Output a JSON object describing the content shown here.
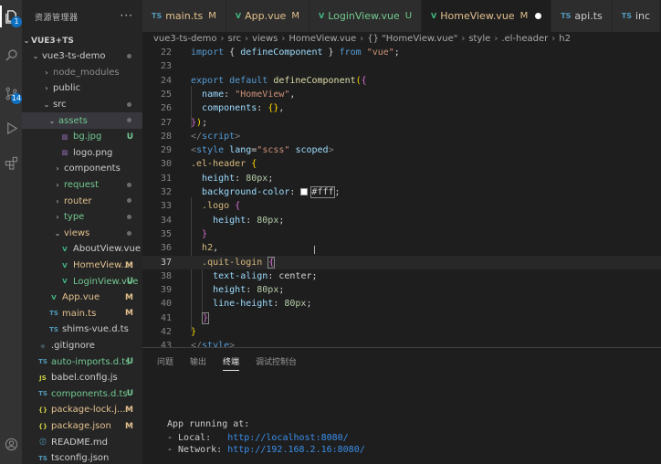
{
  "sidebar": {
    "title": "资源管理器",
    "more": "···",
    "project": "VUE3+TS",
    "items": [
      {
        "label": "vue3-ts-demo",
        "chev": "⌄",
        "color": "#cccccc",
        "icon": "",
        "iconColor": "",
        "dot": true,
        "status": ""
      },
      {
        "label": "node_modules",
        "chev": "›",
        "color": "#8c8c8c",
        "icon": "",
        "iconColor": "",
        "dot": false,
        "status": ""
      },
      {
        "label": "public",
        "chev": "›",
        "color": "#cccccc",
        "icon": "",
        "iconColor": "",
        "dot": false,
        "status": ""
      },
      {
        "label": "src",
        "chev": "⌄",
        "color": "#cccccc",
        "icon": "",
        "iconColor": "",
        "dot": true,
        "status": ""
      },
      {
        "label": "assets",
        "chev": "⌄",
        "color": "#73c991",
        "icon": "",
        "iconColor": "",
        "dot": true,
        "status": ""
      },
      {
        "label": "bg.jpg",
        "chev": "",
        "color": "#73c991",
        "icon": "▨",
        "iconColor": "#a074c4",
        "dot": false,
        "status": "U"
      },
      {
        "label": "logo.png",
        "chev": "",
        "color": "#cccccc",
        "icon": "▨",
        "iconColor": "#a074c4",
        "dot": false,
        "status": ""
      },
      {
        "label": "components",
        "chev": "›",
        "color": "#cccccc",
        "icon": "",
        "iconColor": "",
        "dot": false,
        "status": ""
      },
      {
        "label": "request",
        "chev": "›",
        "color": "#73c991",
        "icon": "",
        "iconColor": "",
        "dot": true,
        "status": ""
      },
      {
        "label": "router",
        "chev": "›",
        "color": "#e2c08d",
        "icon": "",
        "iconColor": "",
        "dot": true,
        "status": ""
      },
      {
        "label": "type",
        "chev": "›",
        "color": "#73c991",
        "icon": "",
        "iconColor": "",
        "dot": true,
        "status": ""
      },
      {
        "label": "views",
        "chev": "⌄",
        "color": "#e2c08d",
        "icon": "",
        "iconColor": "",
        "dot": true,
        "status": ""
      },
      {
        "label": "AboutView.vue",
        "chev": "",
        "color": "#cccccc",
        "icon": "V",
        "iconColor": "#41b883",
        "dot": false,
        "status": ""
      },
      {
        "label": "HomeView....",
        "chev": "",
        "color": "#e2c08d",
        "icon": "V",
        "iconColor": "#41b883",
        "dot": false,
        "status": "M"
      },
      {
        "label": "LoginView.vue",
        "chev": "",
        "color": "#73c991",
        "icon": "V",
        "iconColor": "#41b883",
        "dot": false,
        "status": "U"
      },
      {
        "label": "App.vue",
        "chev": "",
        "color": "#e2c08d",
        "icon": "V",
        "iconColor": "#41b883",
        "dot": false,
        "status": "M"
      },
      {
        "label": "main.ts",
        "chev": "",
        "color": "#e2c08d",
        "icon": "TS",
        "iconColor": "#519aba",
        "dot": false,
        "status": "M"
      },
      {
        "label": "shims-vue.d.ts",
        "chev": "",
        "color": "#cccccc",
        "icon": "TS",
        "iconColor": "#519aba",
        "dot": false,
        "status": ""
      },
      {
        "label": ".gitignore",
        "chev": "",
        "color": "#cccccc",
        "icon": "◆",
        "iconColor": "#41535b",
        "dot": false,
        "status": ""
      },
      {
        "label": "auto-imports.d.ts",
        "chev": "",
        "color": "#73c991",
        "icon": "TS",
        "iconColor": "#519aba",
        "dot": false,
        "status": "U"
      },
      {
        "label": "babel.config.js",
        "chev": "",
        "color": "#cccccc",
        "icon": "JS",
        "iconColor": "#cbcb41",
        "dot": false,
        "status": ""
      },
      {
        "label": "components.d.ts",
        "chev": "",
        "color": "#73c991",
        "icon": "TS",
        "iconColor": "#519aba",
        "dot": false,
        "status": "U"
      },
      {
        "label": "package-lock.j...",
        "chev": "",
        "color": "#e2c08d",
        "icon": "{}",
        "iconColor": "#cbcb41",
        "dot": false,
        "status": "M"
      },
      {
        "label": "package.json",
        "chev": "",
        "color": "#e2c08d",
        "icon": "{}",
        "iconColor": "#cbcb41",
        "dot": false,
        "status": "M"
      },
      {
        "label": "README.md",
        "chev": "",
        "color": "#cccccc",
        "icon": "ⓘ",
        "iconColor": "#519aba",
        "dot": false,
        "status": ""
      },
      {
        "label": "tsconfig.json",
        "chev": "",
        "color": "#cccccc",
        "icon": "TS",
        "iconColor": "#519aba",
        "dot": false,
        "status": ""
      }
    ]
  },
  "activity": {
    "explorer_badge": "1",
    "scm_badge": "14"
  },
  "tabs": [
    {
      "icon": "TS",
      "iconColor": "#519aba",
      "label": "main.ts",
      "status": "M",
      "color": "#e2c08d",
      "active": false
    },
    {
      "icon": "V",
      "iconColor": "#41b883",
      "label": "App.vue",
      "status": "M",
      "color": "#e2c08d",
      "active": false
    },
    {
      "icon": "V",
      "iconColor": "#41b883",
      "label": "LoginView.vue",
      "status": "U",
      "color": "#73c991",
      "active": false
    },
    {
      "icon": "V",
      "iconColor": "#41b883",
      "label": "HomeView.vue",
      "status": "M",
      "color": "#e2c08d",
      "active": true
    },
    {
      "icon": "TS",
      "iconColor": "#519aba",
      "label": "api.ts",
      "status": "",
      "color": "#cccccc",
      "active": false
    },
    {
      "icon": "TS",
      "iconColor": "#519aba",
      "label": "inc",
      "status": "",
      "color": "#cccccc",
      "active": false
    }
  ],
  "breadcrumb": [
    "vue3-ts-demo",
    "src",
    "views",
    "HomeView.vue",
    "{} \"HomeView.vue\"",
    "style",
    ".el-header",
    "h2"
  ],
  "editor": {
    "current_line": 37,
    "lines": [
      {
        "n": 22,
        "parts": [
          [
            "k",
            "import"
          ],
          [
            "pn",
            " { "
          ],
          [
            "p",
            "defineComponent"
          ],
          [
            "pn",
            " } "
          ],
          [
            "k",
            "from"
          ],
          [
            "pn",
            " "
          ],
          [
            "s",
            "\"vue\""
          ],
          [
            "pn",
            ";"
          ]
        ]
      },
      {
        "n": 23,
        "parts": []
      },
      {
        "n": 24,
        "parts": [
          [
            "k",
            "export default"
          ],
          [
            "pn",
            " "
          ],
          [
            "f",
            "defineComponent"
          ],
          [
            "br",
            "("
          ],
          [
            "br2",
            "{"
          ]
        ]
      },
      {
        "n": 25,
        "parts": [
          [
            "pn",
            "  "
          ],
          [
            "p",
            "name"
          ],
          [
            "pn",
            ": "
          ],
          [
            "s",
            "\"HomeView\""
          ],
          [
            "pn",
            ","
          ]
        ]
      },
      {
        "n": 26,
        "parts": [
          [
            "pn",
            "  "
          ],
          [
            "p",
            "components"
          ],
          [
            "pn",
            ": "
          ],
          [
            "br",
            "{}"
          ],
          [
            "pn",
            ","
          ]
        ]
      },
      {
        "n": 27,
        "parts": [
          [
            "br2",
            "}"
          ],
          [
            "br",
            ")"
          ],
          [
            "pn",
            ";"
          ]
        ]
      },
      {
        "n": 28,
        "parts": [
          [
            "t",
            "</"
          ],
          [
            "k",
            "script"
          ],
          [
            "t",
            ">"
          ]
        ]
      },
      {
        "n": 29,
        "parts": [
          [
            "t",
            "<"
          ],
          [
            "k",
            "style"
          ],
          [
            "pn",
            " "
          ],
          [
            "p",
            "lang"
          ],
          [
            "pn",
            "="
          ],
          [
            "s",
            "\"scss\""
          ],
          [
            "pn",
            " "
          ],
          [
            "p",
            "scoped"
          ],
          [
            "t",
            ">"
          ]
        ]
      },
      {
        "n": 30,
        "parts": [
          [
            "sel",
            ".el-header"
          ],
          [
            "pn",
            " "
          ],
          [
            "br",
            "{"
          ]
        ]
      },
      {
        "n": 31,
        "parts": [
          [
            "pn",
            "  "
          ],
          [
            "p",
            "height"
          ],
          [
            "pn",
            ": "
          ],
          [
            "n",
            "80px"
          ],
          [
            "pn",
            ";"
          ]
        ]
      },
      {
        "n": 32,
        "parts": [
          [
            "pn",
            "  "
          ],
          [
            "p",
            "background-color"
          ],
          [
            "pn",
            ": "
          ],
          [
            "swatch",
            ""
          ],
          [
            "hl",
            "#fff"
          ],
          [
            "pn",
            ";"
          ]
        ]
      },
      {
        "n": 33,
        "parts": [
          [
            "pn",
            "  "
          ],
          [
            "sel",
            ".logo"
          ],
          [
            "pn",
            " "
          ],
          [
            "br2",
            "{"
          ]
        ]
      },
      {
        "n": 34,
        "parts": [
          [
            "pn",
            "    "
          ],
          [
            "p",
            "height"
          ],
          [
            "pn",
            ": "
          ],
          [
            "n",
            "80px"
          ],
          [
            "pn",
            ";"
          ]
        ]
      },
      {
        "n": 35,
        "parts": [
          [
            "pn",
            "  "
          ],
          [
            "br2",
            "}"
          ]
        ]
      },
      {
        "n": 36,
        "parts": [
          [
            "pn",
            "  "
          ],
          [
            "sel",
            "h2"
          ],
          [
            "pn",
            ","
          ]
        ]
      },
      {
        "n": 37,
        "parts": [
          [
            "pn",
            "  "
          ],
          [
            "sel",
            ".quit-login"
          ],
          [
            "pn",
            " "
          ],
          [
            "hlb",
            "{"
          ]
        ]
      },
      {
        "n": 38,
        "parts": [
          [
            "pn",
            "    "
          ],
          [
            "p",
            "text-align"
          ],
          [
            "pn",
            ": "
          ],
          [
            "pn",
            "center"
          ],
          [
            "pn",
            ";"
          ]
        ]
      },
      {
        "n": 39,
        "parts": [
          [
            "pn",
            "    "
          ],
          [
            "p",
            "height"
          ],
          [
            "pn",
            ": "
          ],
          [
            "n",
            "80px"
          ],
          [
            "pn",
            ";"
          ]
        ]
      },
      {
        "n": 40,
        "parts": [
          [
            "pn",
            "    "
          ],
          [
            "p",
            "line-height"
          ],
          [
            "pn",
            ": "
          ],
          [
            "n",
            "80px"
          ],
          [
            "pn",
            ";"
          ]
        ]
      },
      {
        "n": 41,
        "parts": [
          [
            "pn",
            "  "
          ],
          [
            "hlb2",
            "}"
          ]
        ]
      },
      {
        "n": 42,
        "parts": [
          [
            "br",
            "}"
          ]
        ]
      },
      {
        "n": 43,
        "parts": [
          [
            "t",
            "</"
          ],
          [
            "k",
            "style"
          ],
          [
            "t",
            ">"
          ]
        ]
      }
    ]
  },
  "panel": {
    "tabs": [
      "问题",
      "输出",
      "终端",
      "调试控制台"
    ],
    "active_tab": "终端",
    "terminal": {
      "line1": "App running at:",
      "local_label": "- Local:   ",
      "local_url": "http://localhost:8080/",
      "network_label": "- Network: ",
      "network_url": "http://192.168.2.16:8080/"
    }
  }
}
